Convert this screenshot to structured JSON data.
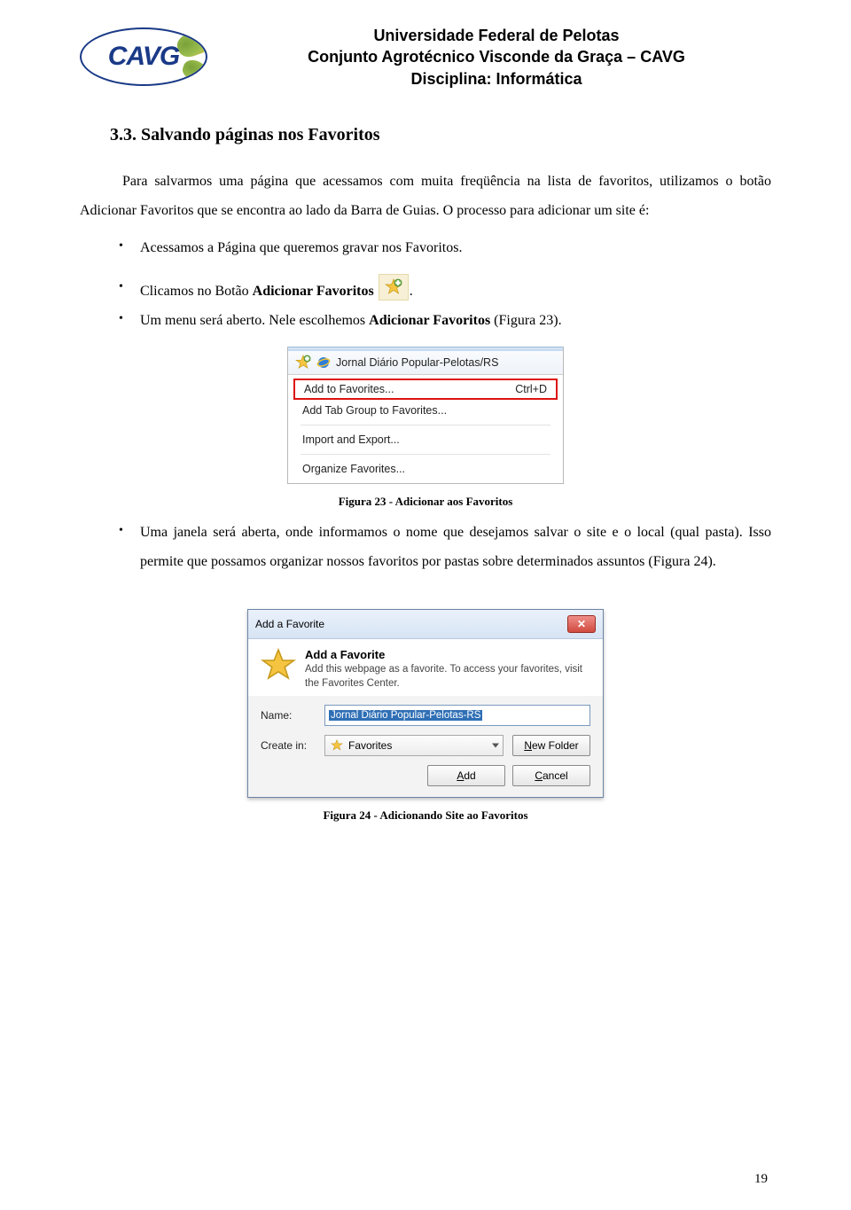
{
  "header": {
    "logo_text": "CAVG",
    "line1": "Universidade Federal de Pelotas",
    "line2": "Conjunto Agrotécnico Visconde da Graça – CAVG",
    "line3": "Disciplina: Informática"
  },
  "section_title": "3.3.   Salvando páginas nos Favoritos",
  "para1": "Para salvarmos uma página que acessamos com muita freqüência na lista de favoritos, utilizamos o botão Adicionar Favoritos que se encontra ao lado da Barra de Guias. O processo para adicionar um site é:",
  "bullets1": {
    "b1": "Acessamos a Página que queremos gravar nos Favoritos.",
    "b2_pre": "Clicamos no Botão ",
    "b2_bold": "Adicionar Favoritos",
    "b2_post": ".",
    "b3_pre": "Um menu será aberto. Nele escolhemos  ",
    "b3_bold": "Adicionar Favoritos",
    "b3_post": " (Figura 23)."
  },
  "fig23": {
    "tab_title": "Jornal Diário Popular-Pelotas/RS",
    "menu": {
      "add": "Add to Favorites...",
      "add_shortcut": "Ctrl+D",
      "add_group": "Add Tab Group to Favorites...",
      "import_export": "Import and Export...",
      "organize": "Organize Favorites..."
    },
    "caption": "Figura 23 - Adicionar aos Favoritos"
  },
  "bullets2": {
    "b1": "Uma janela será aberta, onde informamos o nome que desejamos salvar o site e o local (qual pasta). Isso permite que possamos organizar nossos favoritos por pastas sobre determinados assuntos (Figura 24)."
  },
  "fig24": {
    "dialog_title": "Add a Favorite",
    "heading": "Add a Favorite",
    "desc": "Add this webpage as a favorite. To access your favorites, visit the Favorites Center.",
    "name_label": "Name:",
    "name_value": "Jornal Diário Popular-Pelotas-RS",
    "createin_label": "Create in:",
    "createin_value": "Favorites",
    "new_folder_pre": "N",
    "new_folder_post": "ew Folder",
    "add_pre": "A",
    "add_post": "dd",
    "cancel_pre": "C",
    "cancel_post": "ancel",
    "caption": "Figura 24 - Adicionando Site ao Favoritos"
  },
  "page_number": "19"
}
